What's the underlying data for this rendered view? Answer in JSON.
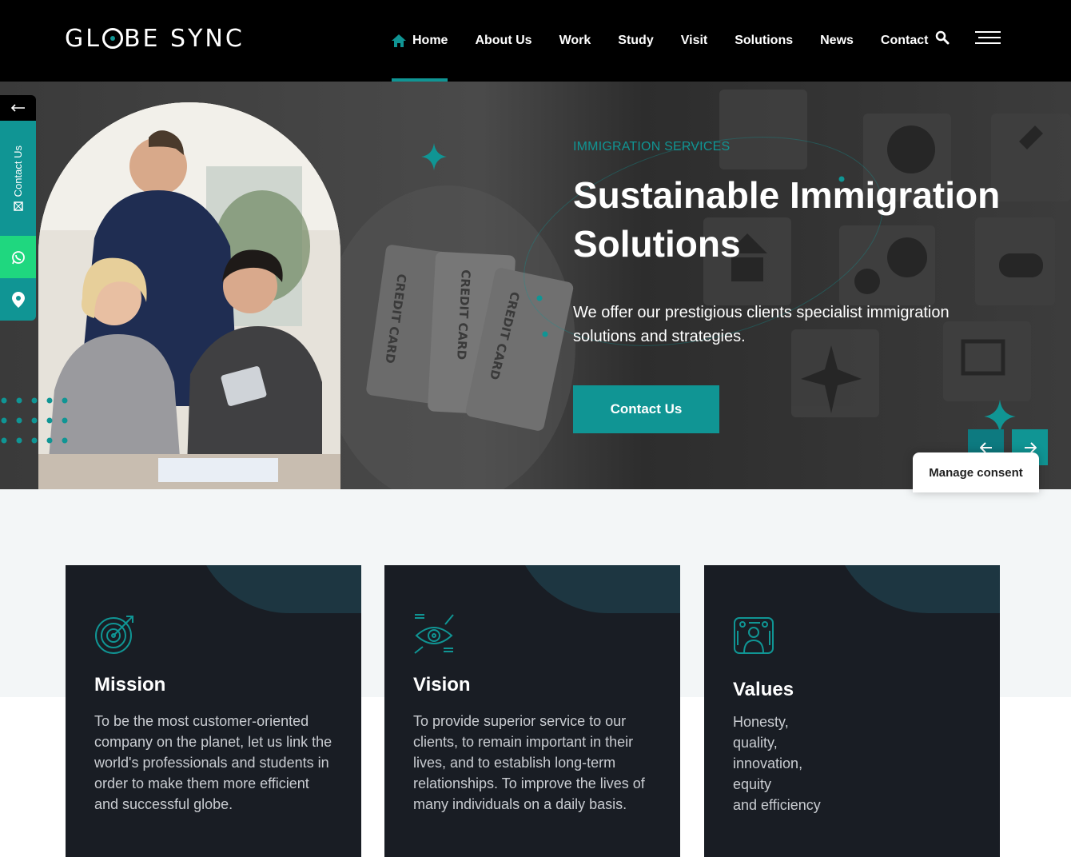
{
  "brand": {
    "logo_text_pre": "GL",
    "logo_text_post": "BE SYNC",
    "accent": "#109594"
  },
  "nav": {
    "items": [
      {
        "label": "Home",
        "icon": "home-icon",
        "active": true
      },
      {
        "label": "About Us"
      },
      {
        "label": "Work"
      },
      {
        "label": "Study"
      },
      {
        "label": "Visit"
      },
      {
        "label": "Solutions"
      },
      {
        "label": "News"
      },
      {
        "label": "Contact"
      }
    ],
    "search_icon": "search-icon",
    "menu_icon": "hamburger-icon"
  },
  "side": {
    "back_icon": "arrow-left-icon",
    "contact_label": "Contact Us",
    "whatsapp_icon": "whatsapp-icon",
    "location_icon": "location-pin-icon"
  },
  "hero": {
    "eyebrow": "IMMIGRATION SERVICES",
    "title": "Sustainable Immigration Solutions",
    "description": "We offer our prestigious clients specialist immigration solutions and strategies.",
    "button_label": "Contact Us",
    "prev_icon": "arrow-left-icon",
    "next_icon": "arrow-right-icon",
    "bg_texts": [
      "CREDIT CARD",
      "CREDIT CARD",
      "CREDIT CARD"
    ]
  },
  "consent": {
    "label": "Manage consent"
  },
  "cards": [
    {
      "title": "Mission",
      "icon": "target-icon",
      "text": "To be the most customer-oriented company on the planet, let us link the world's professionals and students in order to make them more efficient and successful globe."
    },
    {
      "title": "Vision",
      "icon": "eye-vision-icon",
      "text": "To provide superior service to our clients, to remain important in their lives, and to establish long-term relationships. To improve the lives of many individuals on a daily basis."
    },
    {
      "title": "Values",
      "icon": "values-person-icon",
      "lines": [
        "Honesty,",
        "quality,",
        "innovation,",
        "equity",
        "and efficiency"
      ]
    }
  ]
}
